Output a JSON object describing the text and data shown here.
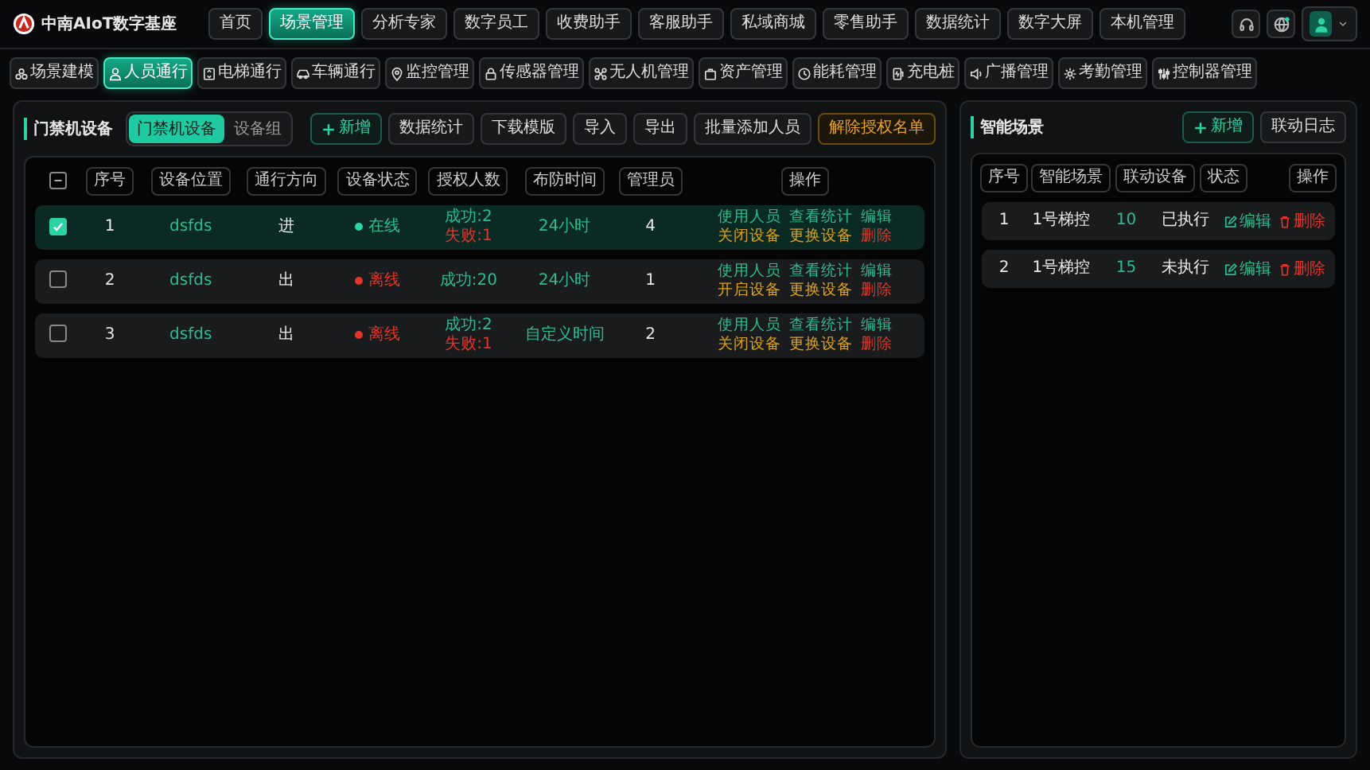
{
  "brand": {
    "name": "中南AIoT数字基座"
  },
  "top_nav": [
    {
      "label": "首页",
      "selected": false
    },
    {
      "label": "场景管理",
      "selected": true
    },
    {
      "label": "分析专家",
      "selected": false
    },
    {
      "label": "数字员工",
      "selected": false
    },
    {
      "label": "收费助手",
      "selected": false
    },
    {
      "label": "客服助手",
      "selected": false
    },
    {
      "label": "私域商城",
      "selected": false
    },
    {
      "label": "零售助手",
      "selected": false
    },
    {
      "label": "数据统计",
      "selected": false
    },
    {
      "label": "数字大屏",
      "selected": false
    },
    {
      "label": "本机管理",
      "selected": false
    }
  ],
  "sub_nav": [
    {
      "label": "场景建模",
      "selected": false
    },
    {
      "label": "人员通行",
      "selected": true
    },
    {
      "label": "电梯通行",
      "selected": false
    },
    {
      "label": "车辆通行",
      "selected": false
    },
    {
      "label": "监控管理",
      "selected": false
    },
    {
      "label": "传感器管理",
      "selected": false
    },
    {
      "label": "无人机管理",
      "selected": false
    },
    {
      "label": "资产管理",
      "selected": false
    },
    {
      "label": "能耗管理",
      "selected": false
    },
    {
      "label": "充电桩",
      "selected": false
    },
    {
      "label": "广播管理",
      "selected": false
    },
    {
      "label": "考勤管理",
      "selected": false
    },
    {
      "label": "控制器管理",
      "selected": false
    }
  ],
  "device_panel": {
    "title": "门禁机设备",
    "view_tabs": [
      {
        "label": "门禁机设备",
        "selected": true
      },
      {
        "label": "设备组",
        "selected": false
      }
    ],
    "buttons": [
      {
        "label": "新增",
        "kind": "add"
      },
      {
        "label": "数据统计",
        "kind": "plain"
      },
      {
        "label": "下载模版",
        "kind": "plain"
      },
      {
        "label": "导入",
        "kind": "plain"
      },
      {
        "label": "导出",
        "kind": "plain"
      },
      {
        "label": "批量添加人员",
        "kind": "plain"
      },
      {
        "label": "解除授权名单",
        "kind": "warning"
      }
    ],
    "select_all": {
      "partial": true
    },
    "columns": [
      "序号",
      "设备位置",
      "通行方向",
      "设备状态",
      "授权人数",
      "布防时间",
      "管理员",
      "操作"
    ],
    "rows": [
      {
        "selected": true,
        "checked": true,
        "index": "1",
        "location": "dsfds",
        "direction": "进",
        "status": "在线",
        "online": true,
        "auth": [
          {
            "text": "成功:2",
            "kind": "success"
          },
          {
            "text": "失败:1",
            "kind": "fail"
          }
        ],
        "schedule": "24小时",
        "admins": "4",
        "actions": [
          {
            "label": "使用人员",
            "kind": "primary"
          },
          {
            "label": "查看统计",
            "kind": "primary"
          },
          {
            "label": "编辑",
            "kind": "primary"
          },
          {
            "label": "关闭设备",
            "kind": "warning"
          },
          {
            "label": "更换设备",
            "kind": "warning"
          },
          {
            "label": "删除",
            "kind": "danger"
          }
        ]
      },
      {
        "selected": false,
        "checked": false,
        "index": "2",
        "location": "dsfds",
        "direction": "出",
        "status": "离线",
        "online": false,
        "auth": [
          {
            "text": "成功:20",
            "kind": "success"
          }
        ],
        "schedule": "24小时",
        "admins": "1",
        "actions": [
          {
            "label": "使用人员",
            "kind": "primary"
          },
          {
            "label": "查看统计",
            "kind": "primary"
          },
          {
            "label": "编辑",
            "kind": "primary"
          },
          {
            "label": "开启设备",
            "kind": "warning"
          },
          {
            "label": "更换设备",
            "kind": "warning"
          },
          {
            "label": "删除",
            "kind": "danger"
          }
        ]
      },
      {
        "selected": false,
        "checked": false,
        "index": "3",
        "location": "dsfds",
        "direction": "出",
        "status": "离线",
        "online": false,
        "auth": [
          {
            "text": "成功:2",
            "kind": "success"
          },
          {
            "text": "失败:1",
            "kind": "fail"
          }
        ],
        "schedule": "自定义时间",
        "admins": "2",
        "actions": [
          {
            "label": "使用人员",
            "kind": "primary"
          },
          {
            "label": "查看统计",
            "kind": "primary"
          },
          {
            "label": "编辑",
            "kind": "primary"
          },
          {
            "label": "关闭设备",
            "kind": "warning"
          },
          {
            "label": "更换设备",
            "kind": "warning"
          },
          {
            "label": "删除",
            "kind": "danger"
          }
        ]
      }
    ]
  },
  "scene_panel": {
    "title": "智能场景",
    "buttons": [
      {
        "label": "新增",
        "kind": "add"
      },
      {
        "label": "联动日志",
        "kind": "plain"
      }
    ],
    "columns": [
      "序号",
      "智能场景",
      "联动设备",
      "状态",
      "操作"
    ],
    "rows": [
      {
        "index": "1",
        "name": "1号梯控",
        "devices": "10",
        "status": "已执行",
        "actions": [
          {
            "label": "编辑",
            "kind": "edit"
          },
          {
            "label": "删除",
            "kind": "delete"
          }
        ]
      },
      {
        "index": "2",
        "name": "1号梯控",
        "devices": "15",
        "status": "未执行",
        "actions": [
          {
            "label": "编辑",
            "kind": "edit"
          },
          {
            "label": "删除",
            "kind": "delete"
          }
        ]
      }
    ]
  }
}
